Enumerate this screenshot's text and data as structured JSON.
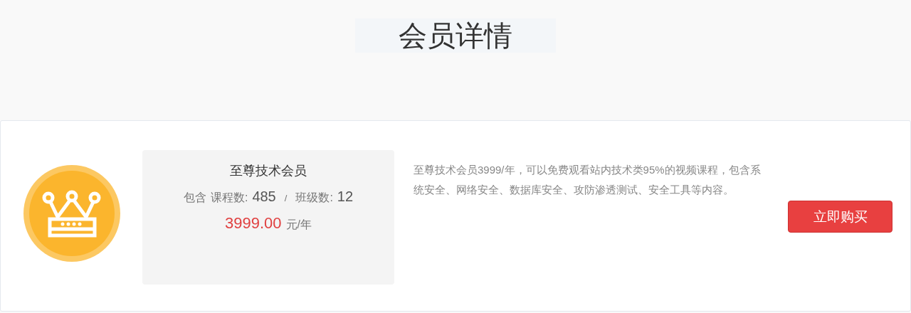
{
  "page_title": "会员详情",
  "plan": {
    "name": "至尊技术会员",
    "includes_label": "包含",
    "courses_label": "课程数:",
    "courses": "485",
    "separator": "/",
    "classes_label": "班级数:",
    "classes": "12",
    "price": "3999.00",
    "price_unit": "元/年"
  },
  "description": "至尊技术会员3999/年，可以免费观看站内技术类95%的视频课程，包含系统安全、网络安全、数据库安全、攻防渗透测试、安全工具等内容。",
  "buy_button": "立即购买"
}
